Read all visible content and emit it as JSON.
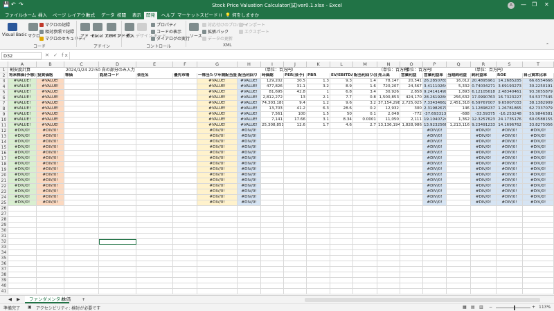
{
  "title": {
    "window_title": "Stock Price Valuation Calculator(試)ver0.1.xlsx  -  Excel",
    "avatar": "A",
    "min": "—",
    "restore": "❐",
    "close": "✕",
    "save_icon": "save-icon",
    "undo_icon": "undo-icon",
    "redo_icon": "redo-icon"
  },
  "tabs": [
    "ファイル",
    "ホーム",
    "挿入",
    "ページ レイアウト",
    "数式",
    "データ",
    "校閲",
    "表示",
    "開発",
    "ヘルプ",
    "マーケットスピード II",
    "何をしますか"
  ],
  "ribbon": {
    "code": {
      "vb": "Visual Basic",
      "macro": "マクロ",
      "rec": "マクロの記録",
      "rel": "相対参照で記録",
      "sec": "マクロのセキュリティ",
      "label": "コード"
    },
    "addin": {
      "addin": "アド イン",
      "excel": "Excel アドイン",
      "com": "COM アドイン",
      "label": "アドイン"
    },
    "controls": {
      "insert": "挿入",
      "design": "デザイン モード",
      "prop": "プロパティ",
      "code": "コードの表示",
      "dialog": "ダイアログの実行",
      "label": "コントロール"
    },
    "xml": {
      "source": "ソース",
      "map": "対応付けのプロパティ",
      "pack": "拡張パック",
      "refresh": "データの更新",
      "imp": "インポート",
      "exp": "エクスポート",
      "label": "XML"
    }
  },
  "formula": {
    "namebox": "D32",
    "symbols": "✕  ✓  fx"
  },
  "columns": [
    "A",
    "B",
    "C",
    "D",
    "E",
    "F",
    "G",
    "H",
    "I",
    "J",
    "K",
    "L",
    "M",
    "N",
    "O",
    "P",
    "Q",
    "R",
    "S",
    "T"
  ],
  "rows": [
    "1",
    "2",
    "3",
    "4",
    "5",
    "6",
    "7",
    "8",
    "9",
    "10",
    "11",
    "12",
    "13",
    "14",
    "15",
    "16",
    "17",
    "18",
    "19",
    "20",
    "21",
    "22",
    "23",
    "24",
    "25",
    "26",
    "27",
    "28",
    "29",
    "30",
    "31",
    "32",
    "33",
    "34",
    "35",
    "36",
    "37",
    "38",
    "39",
    "40",
    "41"
  ],
  "row1": {
    "a": "割安度計算",
    "c": "2024/1/24 22:50  白の部分のみ入力",
    "i": "（単位：百万円）",
    "n": "（単位：百万円）",
    "o": "（単位：百万円）",
    "r": "（単位：百万円）"
  },
  "headers": [
    "将来株価(予想)",
    "投資価格",
    "株価",
    "銘柄コード",
    "会社名",
    "優先市場",
    "一株当たり年間配当金",
    "配当利回り",
    "時価総",
    "PER(会予)",
    "PBR",
    "EV/EBITDA",
    "配当利回り(会予)",
    "売上高",
    "営業利益",
    "営業利益率",
    "当期純利益",
    "純利益率",
    "ROE",
    "自己資本比率"
  ],
  "data_rows": [
    [
      "#VALUE!",
      "#VALUE!",
      "",
      "",
      "",
      "",
      "#VALUE!",
      "#VALUE!",
      "129,202",
      "30.5",
      "1.3",
      "9.3",
      "1.4",
      "78,147",
      "20,541",
      "26.2850781",
      "16,012",
      "20.4895961",
      "14.2685285",
      "66.6554666"
    ],
    [
      "#VALUE!",
      "#VALUE!",
      "",
      "",
      "",
      "",
      "#VALUE!",
      "#VALUE!",
      "477,826",
      "31.1",
      "3.2",
      "8.9",
      "1.6",
      "720,207",
      "24,567",
      "3.41110264",
      "5,332",
      "0.74034271",
      "3.69193273",
      "30.2250191"
    ],
    [
      "#VALUE!",
      "#VALUE!",
      "",
      "",
      "",
      "",
      "#VALUE!",
      "#VALUE!",
      "81,695",
      "42.8",
      "1",
      "6.8",
      "3.4",
      "30,926",
      "2,858",
      "9.24141499",
      "1,893",
      "6.12105618",
      "2.48340461",
      "93.3055879"
    ],
    [
      "#VALUE!",
      "#VALUE!",
      "",
      "",
      "",
      "",
      "#VALUE!",
      "#VALUE!",
      "2,812,272",
      "13",
      "2.1",
      "7.7",
      "0.8",
      "1,500,853",
      "424,170",
      "28.2619284",
      "256,632",
      "17.0990763",
      "16.7323227",
      "54.5377545"
    ],
    [
      "#VALUE!",
      "#VALUE!",
      "",
      "",
      "",
      "",
      "#VALUE!",
      "#VALUE!",
      "74,303,180",
      "9.4",
      "1.2",
      "9.6",
      "3.2",
      "37,154,298",
      "2,725,025",
      "7.33434662",
      "2,451,318",
      "6.59767007",
      "9.65007033",
      "38.1382909"
    ],
    [
      "#VALUE!",
      "#VALUE!",
      "",
      "",
      "",
      "",
      "#VALUE!",
      "#VALUE!",
      "13,703",
      "41.2",
      "6.3",
      "28.6",
      "0.2",
      "12,932",
      "300",
      "2.31982679",
      "146",
      "1.12898237",
      "1.26781865",
      "62.7337079"
    ],
    [
      "#VALUE!",
      "#VALUE!",
      "",
      "",
      "",
      "",
      "#VALUE!",
      "#VALUE!",
      "7,561",
      "100",
      "1.5",
      "50",
      "0.1",
      "2,048",
      "-772",
      "-37.693313",
      "-688",
      "-33.59375",
      "-16.253248",
      "55.9846581"
    ],
    [
      "#VALUE!",
      "#VALUE!",
      "",
      "",
      "",
      "",
      "#VALUE!",
      "#VALUE!",
      "7,141",
      "17.66",
      "3.1",
      "8.34",
      "0.0001",
      "11,050",
      "2,111",
      "19.1040724",
      "1,362",
      "12.3257623",
      "24.1735176",
      "60.0588155"
    ],
    [
      "#VALUE!",
      "#VALUE!",
      "",
      "",
      "",
      "",
      "#VALUE!",
      "#VALUE!",
      "25,308,851",
      "12.6",
      "1.7",
      "4.6",
      "2.7",
      "13,136,194",
      "1,828,986",
      "13.9232566",
      "1,213,116",
      "9.23491233",
      "14.1696762",
      "33.8275056"
    ],
    [
      "#DIV/0!",
      "#DIV/0!",
      "",
      "",
      "",
      "",
      "#DIV/0!",
      "#DIV/0!",
      "",
      "",
      "",
      "",
      "",
      "",
      "",
      "#DIV/0!",
      "",
      "#DIV/0!",
      "#DIV/0!",
      "#DIV/0!"
    ],
    [
      "#DIV/0!",
      "#DIV/0!",
      "",
      "",
      "",
      "",
      "#DIV/0!",
      "#DIV/0!",
      "",
      "",
      "",
      "",
      "",
      "",
      "",
      "#DIV/0!",
      "",
      "#DIV/0!",
      "#DIV/0!",
      "#DIV/0!"
    ],
    [
      "#DIV/0!",
      "#DIV/0!",
      "",
      "",
      "",
      "",
      "#DIV/0!",
      "#DIV/0!",
      "",
      "",
      "",
      "",
      "",
      "",
      "",
      "#DIV/0!",
      "",
      "#DIV/0!",
      "#DIV/0!",
      "#DIV/0!"
    ],
    [
      "#DIV/0!",
      "#DIV/0!",
      "",
      "",
      "",
      "",
      "#DIV/0!",
      "#DIV/0!",
      "",
      "",
      "",
      "",
      "",
      "",
      "",
      "#DIV/0!",
      "",
      "#DIV/0!",
      "#DIV/0!",
      "#DIV/0!"
    ],
    [
      "#DIV/0!",
      "#DIV/0!",
      "",
      "",
      "",
      "",
      "#DIV/0!",
      "#DIV/0!",
      "",
      "",
      "",
      "",
      "",
      "",
      "",
      "#DIV/0!",
      "",
      "#DIV/0!",
      "#DIV/0!",
      "#DIV/0!"
    ],
    [
      "#DIV/0!",
      "#DIV/0!",
      "",
      "",
      "",
      "",
      "#DIV/0!",
      "#DIV/0!",
      "",
      "",
      "",
      "",
      "",
      "",
      "",
      "#DIV/0!",
      "",
      "#DIV/0!",
      "#DIV/0!",
      "#DIV/0!"
    ],
    [
      "#DIV/0!",
      "#DIV/0!",
      "",
      "",
      "",
      "",
      "#DIV/0!",
      "#DIV/0!",
      "",
      "",
      "",
      "",
      "",
      "",
      "",
      "#DIV/0!",
      "",
      "#DIV/0!",
      "#DIV/0!",
      "#DIV/0!"
    ],
    [
      "#DIV/0!",
      "#DIV/0!",
      "",
      "",
      "",
      "",
      "#DIV/0!",
      "#DIV/0!",
      "",
      "",
      "",
      "",
      "",
      "",
      "",
      "#DIV/0!",
      "",
      "#DIV/0!",
      "#DIV/0!",
      "#DIV/0!"
    ],
    [
      "#DIV/0!",
      "#DIV/0!",
      "",
      "",
      "",
      "",
      "#DIV/0!",
      "#DIV/0!",
      "",
      "",
      "",
      "",
      "",
      "",
      "",
      "#DIV/0!",
      "",
      "#DIV/0!",
      "#DIV/0!",
      "#DIV/0!"
    ],
    [
      "#DIV/0!",
      "#DIV/0!",
      "",
      "",
      "",
      "",
      "#DIV/0!",
      "#DIV/0!",
      "",
      "",
      "",
      "",
      "",
      "",
      "",
      "#DIV/0!",
      "",
      "#DIV/0!",
      "#DIV/0!",
      "#DIV/0!"
    ],
    [
      "#DIV/0!",
      "#DIV/0!",
      "",
      "",
      "",
      "",
      "#DIV/0!",
      "#DIV/0!",
      "",
      "",
      "",
      "",
      "",
      "",
      "",
      "#DIV/0!",
      "",
      "#DIV/0!",
      "#DIV/0!",
      "#DIV/0!"
    ],
    [
      "#DIV/0!",
      "#DIV/0!",
      "",
      "",
      "",
      "",
      "#DIV/0!",
      "#DIV/0!",
      "",
      "",
      "",
      "",
      "",
      "",
      "",
      "#DIV/0!",
      "",
      "#DIV/0!",
      "#DIV/0!",
      "#DIV/0!"
    ],
    [
      "#DIV/0!",
      "#DIV/0!",
      "",
      "",
      "",
      "",
      "#DIV/0!",
      "#DIV/0!",
      "",
      "",
      "",
      "",
      "",
      "",
      "",
      "#DIV/0!",
      "",
      "#DIV/0!",
      "#DIV/0!",
      "#DIV/0!"
    ],
    [
      "#DIV/0!",
      "#DIV/0!",
      "",
      "",
      "",
      "",
      "#DIV/0!",
      "#DIV/0!",
      "",
      "",
      "",
      "",
      "",
      "",
      "",
      "#DIV/0!",
      "",
      "#DIV/0!",
      "#DIV/0!",
      "#DIV/0!"
    ]
  ],
  "colors": {
    "green": "#d9efd0",
    "peach": "#fcd9c0",
    "yellow": "#fff2cc",
    "blue": "#d6e4f3",
    "excel": "#217346"
  },
  "sheets": {
    "prev": "◀",
    "next": "▶",
    "tabs": [
      "ファンダメンタル",
      "株価"
    ],
    "add": "+"
  },
  "status": {
    "ready": "準備完了",
    "a11y": "アクセシビリティ: 検討が必要です",
    "zoom": "113%",
    "minus": "−",
    "plus": "+"
  }
}
